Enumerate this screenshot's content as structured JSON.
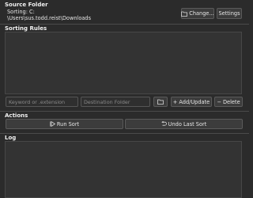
{
  "source_folder": {
    "title": "Source Folder",
    "sorting_label": "Sorting: C:",
    "path": "\\Users\\sus.todd.reist\\Downloads",
    "change_button": "Change...",
    "settings_button": "Settings"
  },
  "sorting_rules": {
    "title": "Sorting Rules",
    "keyword_placeholder": "Keyword or .extension",
    "destination_placeholder": "Destination Folder",
    "add_update_button": "+ Add/Update",
    "delete_button": "− Delete"
  },
  "actions": {
    "title": "Actions",
    "run_sort_button": "Run Sort",
    "undo_button": "Undo Last Sort"
  },
  "log": {
    "title": "Log"
  },
  "icons": {
    "change_folder": "folder-icon",
    "browse_folder": "folder-icon",
    "run": "play-icon",
    "undo": "undo-icon"
  }
}
